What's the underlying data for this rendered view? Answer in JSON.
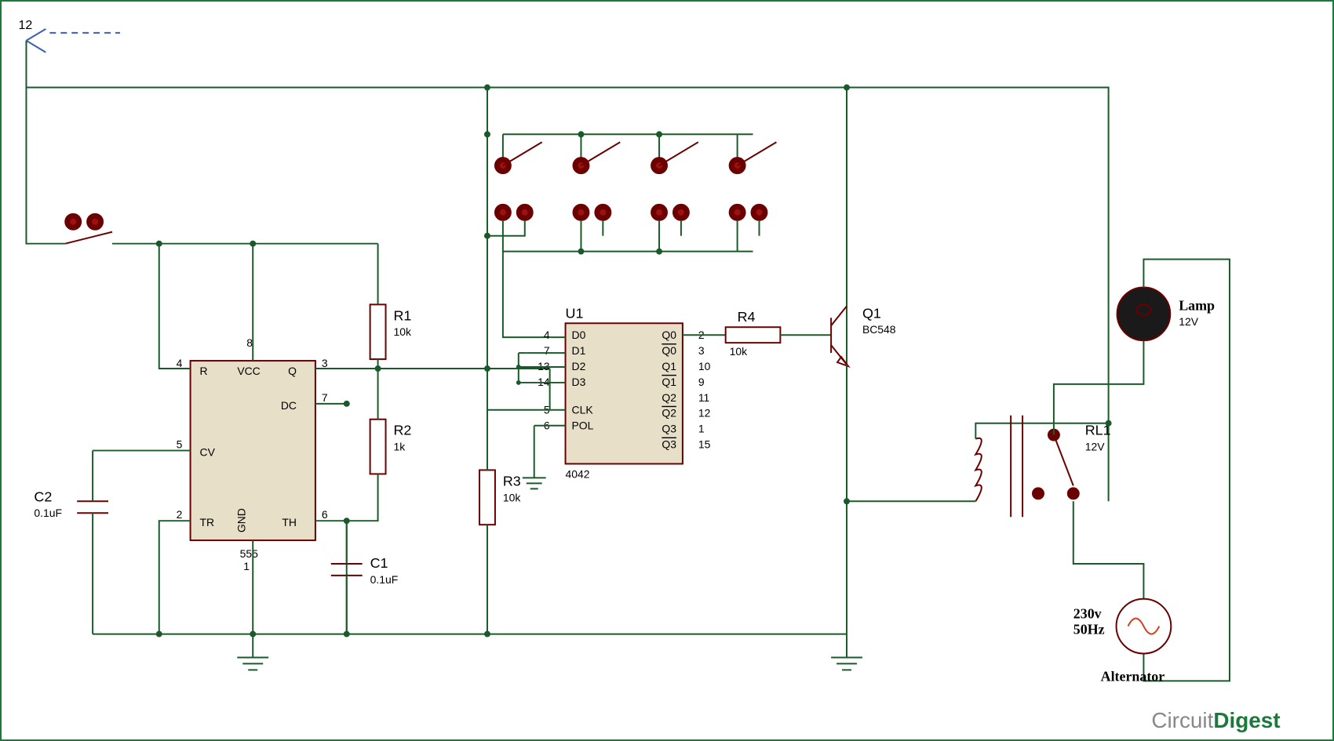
{
  "supply": {
    "voltage_label": "12"
  },
  "ic1": {
    "ref": "U1",
    "part": "4042",
    "pins_left": [
      "4",
      "7",
      "13",
      "14",
      "5",
      "6"
    ],
    "labels_left": [
      "D0",
      "D1",
      "D2",
      "D3",
      "CLK",
      "POL"
    ],
    "pins_right": [
      "2",
      "3",
      "10",
      "9",
      "11",
      "12",
      "1",
      "15"
    ],
    "labels_right": [
      "Q0",
      "Q0",
      "Q1",
      "Q1",
      "Q2",
      "Q2",
      "Q3",
      "Q3"
    ]
  },
  "ic2": {
    "part": "555",
    "labels": {
      "R": "R",
      "VCC": "VCC",
      "Q": "Q",
      "DC": "DC",
      "CV": "CV",
      "TR": "TR",
      "GND": "GND",
      "TH": "TH"
    },
    "pins": {
      "R": "4",
      "VCC": "8",
      "Q": "3",
      "DC": "7",
      "CV": "5",
      "TR": "2",
      "GND": "1",
      "TH": "6"
    }
  },
  "resistors": {
    "R1": {
      "ref": "R1",
      "value": "10k"
    },
    "R2": {
      "ref": "R2",
      "value": "1k"
    },
    "R3": {
      "ref": "R3",
      "value": "10k"
    },
    "R4": {
      "ref": "R4",
      "value": "10k"
    }
  },
  "capacitors": {
    "C1": {
      "ref": "C1",
      "value": "0.1uF"
    },
    "C2": {
      "ref": "C2",
      "value": "0.1uF"
    }
  },
  "transistor": {
    "ref": "Q1",
    "part": "BC548"
  },
  "relay": {
    "ref": "RL1",
    "value": "12V"
  },
  "lamp": {
    "ref": "Lamp",
    "value": "12V"
  },
  "ac": {
    "voltage": "230v",
    "freq": "50Hz",
    "label": "Alternator"
  },
  "logo": {
    "part1": "Circuit",
    "part2": "Digest"
  }
}
